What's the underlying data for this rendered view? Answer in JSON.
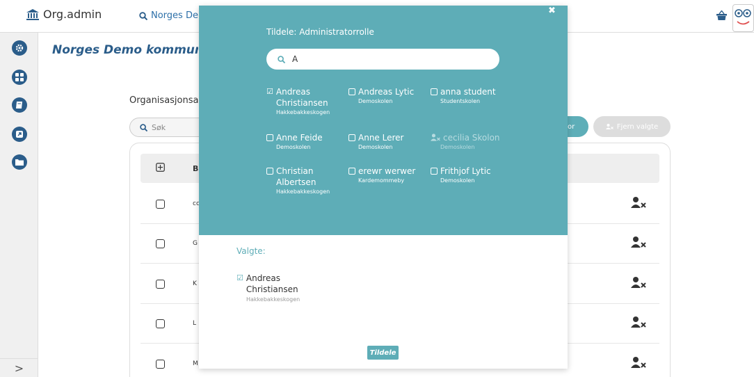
{
  "app": {
    "title": "Org.admin"
  },
  "topbar": {
    "search_text": "Norges Dem"
  },
  "breadcrumb": "Norges Demo kommune > (",
  "section_title": "Organisasjonsad",
  "bg_search_placeholder": "Søk",
  "buttons": {
    "partial_label": "or",
    "remove_selected": "Fjern valgte",
    "assign": "Tildele"
  },
  "table": {
    "col_b": "B",
    "rows": [
      "cc",
      "G",
      "K",
      "L",
      "M"
    ]
  },
  "modal": {
    "title": "Tildele: Administratorrolle",
    "search_value": "A",
    "people": [
      {
        "name": "Andreas Christiansen",
        "org": "Hakkebakkeskogen",
        "checked": true,
        "disabled": false
      },
      {
        "name": "Andreas Lytic",
        "org": "Demoskolen",
        "checked": false,
        "disabled": false
      },
      {
        "name": "anna student",
        "org": "Studentskolen",
        "checked": false,
        "disabled": false
      },
      {
        "name": "Anne Feide",
        "org": "Demoskolen",
        "checked": false,
        "disabled": false
      },
      {
        "name": "Anne Lerer",
        "org": "Demoskolen",
        "checked": false,
        "disabled": false
      },
      {
        "name": "cecilia Skolon",
        "org": "Demoskolen",
        "checked": false,
        "disabled": true
      },
      {
        "name": "Christian Albertsen",
        "org": "Hakkebakkeskogen",
        "checked": false,
        "disabled": false
      },
      {
        "name": "erewr werwer",
        "org": "Kardemommeby",
        "checked": false,
        "disabled": false
      },
      {
        "name": "Frithjof Lytic",
        "org": "Demoskolen",
        "checked": false,
        "disabled": false
      }
    ],
    "selected_label": "Valgte:",
    "selected": [
      {
        "name": "Andreas Christiansen",
        "org": "Hakkebakkeskogen"
      }
    ]
  },
  "colors": {
    "teal": "#5eadb7",
    "navy": "#2b5d8a"
  },
  "icons": [
    "bank-icon",
    "search-icon",
    "basket-icon",
    "gear-icon",
    "grid-icon",
    "book-icon",
    "external-link-icon",
    "folder-icon",
    "chevron-right-icon",
    "remove-user-icon",
    "close-icon",
    "checkbox-checked-icon",
    "plus-square-icon"
  ]
}
